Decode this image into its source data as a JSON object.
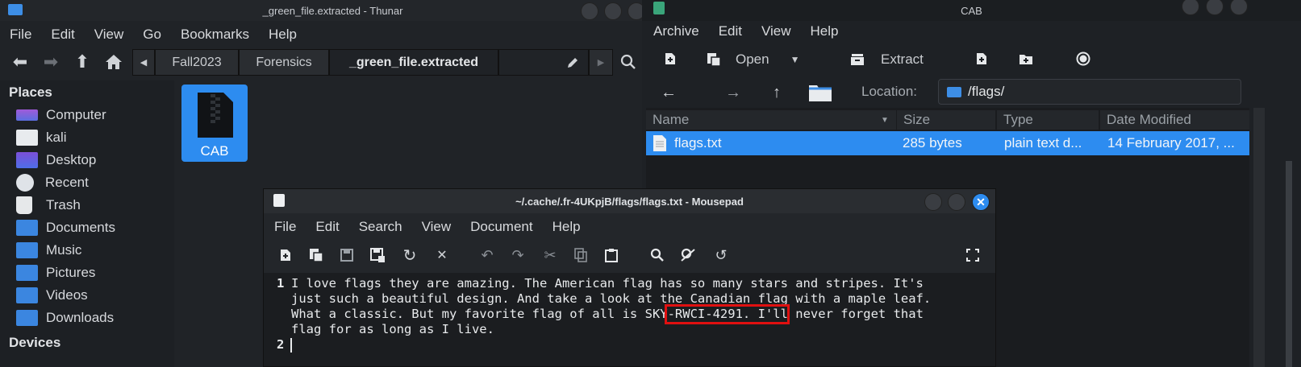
{
  "thunar": {
    "title": "_green_file.extracted - Thunar",
    "menu": [
      "File",
      "Edit",
      "View",
      "Go",
      "Bookmarks",
      "Help"
    ],
    "breadcrumbs": [
      "Fall2023",
      "Forensics",
      "_green_file.extracted"
    ],
    "places_header": "Places",
    "places": [
      "Computer",
      "kali",
      "Desktop",
      "Recent",
      "Trash",
      "Documents",
      "Music",
      "Pictures",
      "Videos",
      "Downloads"
    ],
    "devices_header": "Devices",
    "file": {
      "name": "CAB"
    }
  },
  "cab": {
    "title": "CAB",
    "menu": [
      "Archive",
      "Edit",
      "View",
      "Help"
    ],
    "toolbar": {
      "open_label": "Open",
      "extract_label": "Extract"
    },
    "location_label": "Location:",
    "location_value": "/flags/",
    "columns": [
      "Name",
      "Size",
      "Type",
      "Date Modified"
    ],
    "rows": [
      {
        "name": "flags.txt",
        "size": "285 bytes",
        "type": "plain text d...",
        "modified": "14 February 2017, ..."
      }
    ]
  },
  "mousepad": {
    "title": "~/.cache/.fr-4UKpjB/flags/flags.txt - Mousepad",
    "menu": [
      "File",
      "Edit",
      "Search",
      "View",
      "Document",
      "Help"
    ],
    "line_numbers": [
      "1",
      "2"
    ],
    "lines": [
      "I love flags they are amazing. The American flag has so many stars and stripes. It's",
      "just such a beautiful design. And take a look at the Canadian flag with a maple leaf.",
      "What a classic. But my favorite flag of all is ",
      "SKY-RWCI-4291.",
      " I'll never forget that",
      "flag for as long as I live."
    ]
  },
  "colors": {
    "accent": "#2d8cf0",
    "highlight_box": "#e01010"
  }
}
